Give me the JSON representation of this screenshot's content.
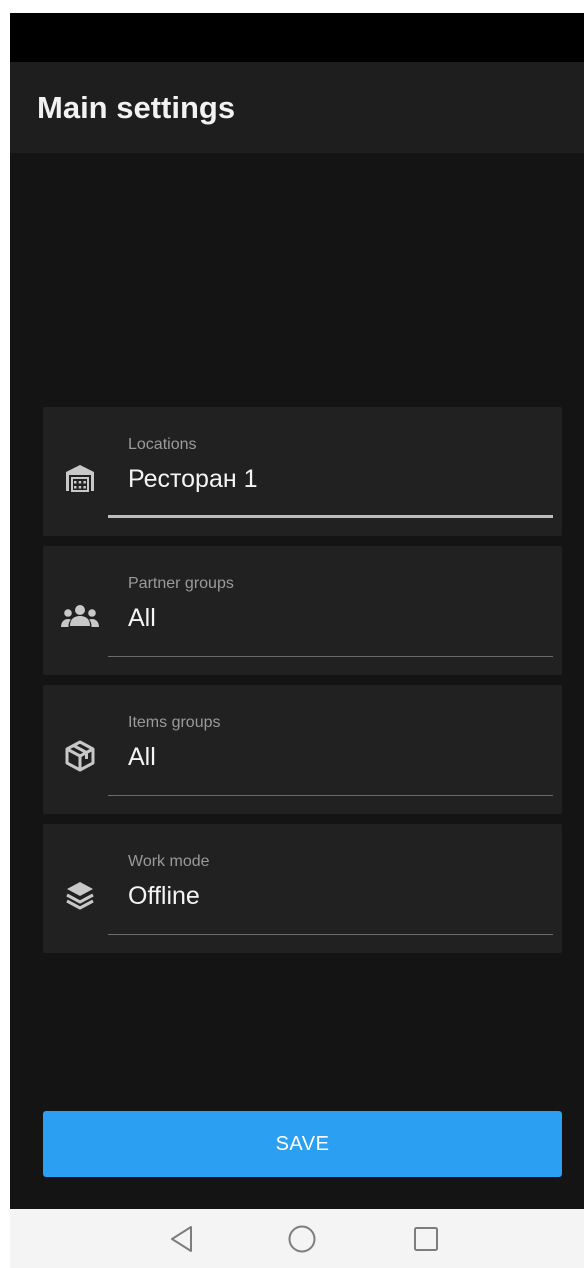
{
  "header": {
    "title": "Main settings"
  },
  "settings": [
    {
      "label": "Locations",
      "value": "Ресторан 1",
      "icon": "warehouse-icon",
      "active": true
    },
    {
      "label": "Partner groups",
      "value": "All",
      "icon": "group-icon",
      "active": false
    },
    {
      "label": "Items groups",
      "value": "All",
      "icon": "box-icon",
      "active": false
    },
    {
      "label": "Work mode",
      "value": "Offline",
      "icon": "layers-icon",
      "active": false
    }
  ],
  "actions": {
    "save_label": "SAVE"
  },
  "nav": {
    "buttons": [
      "back-icon",
      "home-icon",
      "recents-icon"
    ]
  },
  "colors": {
    "accent": "#2b9ff1",
    "background": "#141414",
    "card": "#212121",
    "app_bar": "#1e1e1e"
  }
}
